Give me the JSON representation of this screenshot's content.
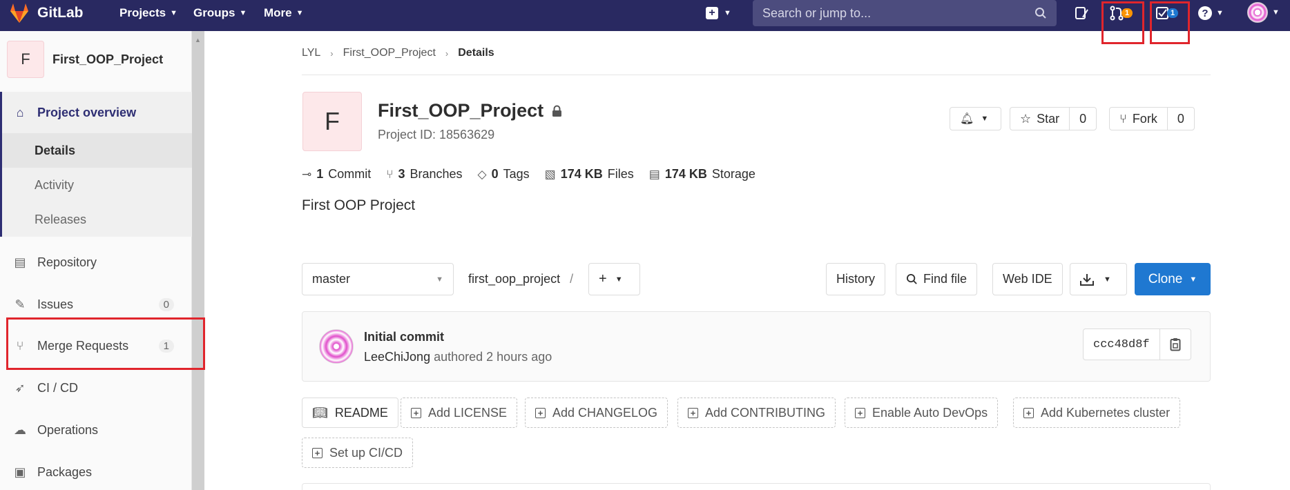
{
  "navbar": {
    "brand": "GitLab",
    "menus": [
      {
        "label": "Projects"
      },
      {
        "label": "Groups"
      },
      {
        "label": "More"
      }
    ],
    "search_placeholder": "Search or jump to...",
    "merge_requests_count": "1",
    "todos_count": "1"
  },
  "sidebar": {
    "project_initial": "F",
    "project_name": "First_OOP_Project",
    "overview_label": "Project overview",
    "sub_items": [
      "Details",
      "Activity",
      "Releases"
    ],
    "items": [
      {
        "label": "Repository",
        "icon": "document-icon"
      },
      {
        "label": "Issues",
        "icon": "issues-icon",
        "count": "0"
      },
      {
        "label": "Merge Requests",
        "icon": "merge-request-icon",
        "count": "1"
      },
      {
        "label": "CI / CD",
        "icon": "rocket-icon"
      },
      {
        "label": "Operations",
        "icon": "cloud-gear-icon"
      },
      {
        "label": "Packages",
        "icon": "package-icon"
      }
    ]
  },
  "breadcrumb": [
    "LYL",
    "First_OOP_Project",
    "Details"
  ],
  "project": {
    "initial": "F",
    "title": "First_OOP_Project",
    "id_text": "Project ID: 18563629",
    "star_label": "Star",
    "star_count": "0",
    "fork_label": "Fork",
    "fork_count": "0",
    "description": "First OOP Project"
  },
  "stats": {
    "commits_num": "1",
    "commits_label": "Commit",
    "branches_num": "3",
    "branches_label": "Branches",
    "tags_num": "0",
    "tags_label": "Tags",
    "files_num": "174 KB",
    "files_label": "Files",
    "storage_num": "174 KB",
    "storage_label": "Storage"
  },
  "repo": {
    "branch": "master",
    "path": "first_oop_project",
    "path_sep": "/",
    "history_label": "History",
    "find_file_label": "Find file",
    "web_ide_label": "Web IDE",
    "clone_label": "Clone"
  },
  "commit": {
    "title": "Initial commit",
    "author": "LeeChiJong",
    "meta": "authored 2 hours ago",
    "sha": "ccc48d8f"
  },
  "quick_actions": [
    "README",
    "Add LICENSE",
    "Add CHANGELOG",
    "Add CONTRIBUTING",
    "Enable Auto DevOps",
    "Add Kubernetes cluster",
    "Set up CI/CD"
  ],
  "colors": {
    "navbar": "#292961",
    "primary": "#1f78d1",
    "badge_orange": "#fc9403",
    "annotation_red": "#e0252c"
  }
}
